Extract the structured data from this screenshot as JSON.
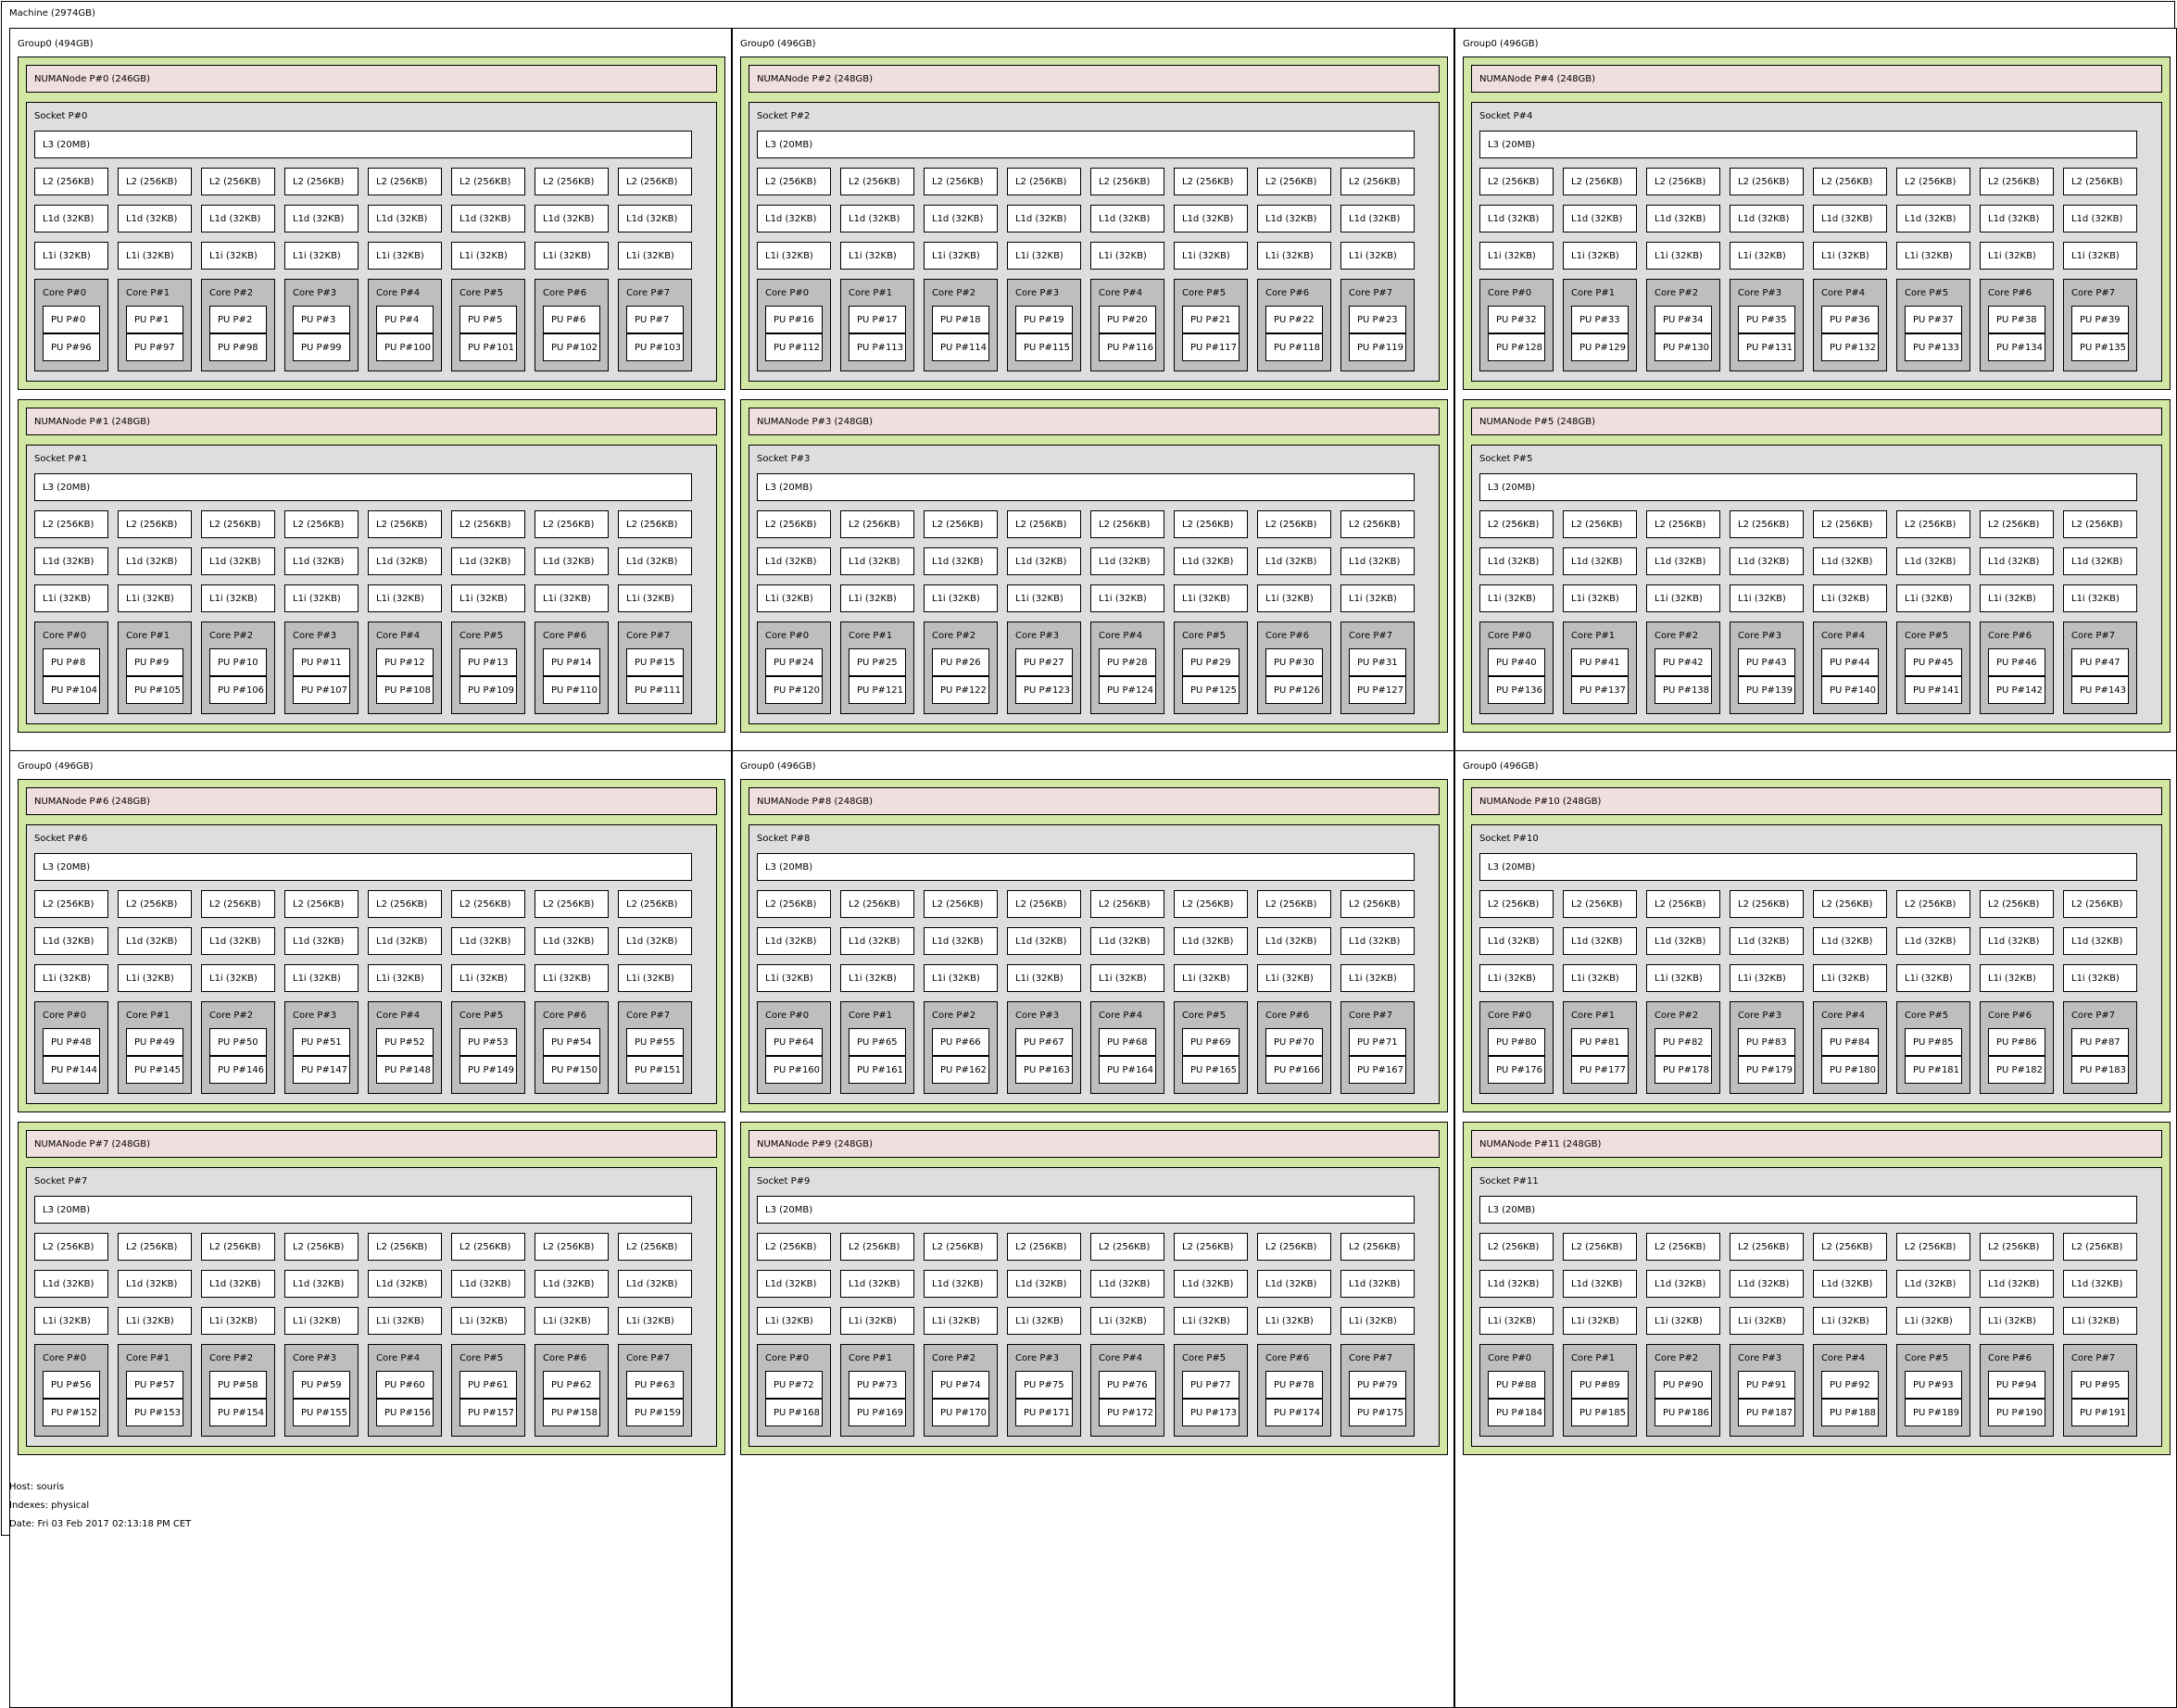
{
  "machine": {
    "label": "Machine (2974GB)"
  },
  "groups": [
    {
      "label": "Group0 (494GB)",
      "numas": [
        {
          "label": "NUMANode P#0 (246GB)",
          "socket": "Socket P#0",
          "pu_start": 0,
          "pu_ht_start": 96
        },
        {
          "label": "NUMANode P#1 (248GB)",
          "socket": "Socket P#1",
          "pu_start": 8,
          "pu_ht_start": 104
        }
      ]
    },
    {
      "label": "Group0 (496GB)",
      "numas": [
        {
          "label": "NUMANode P#2 (248GB)",
          "socket": "Socket P#2",
          "pu_start": 16,
          "pu_ht_start": 112
        },
        {
          "label": "NUMANode P#3 (248GB)",
          "socket": "Socket P#3",
          "pu_start": 24,
          "pu_ht_start": 120
        }
      ]
    },
    {
      "label": "Group0 (496GB)",
      "numas": [
        {
          "label": "NUMANode P#4 (248GB)",
          "socket": "Socket P#4",
          "pu_start": 32,
          "pu_ht_start": 128
        },
        {
          "label": "NUMANode P#5 (248GB)",
          "socket": "Socket P#5",
          "pu_start": 40,
          "pu_ht_start": 136
        }
      ]
    },
    {
      "label": "Group0 (496GB)",
      "numas": [
        {
          "label": "NUMANode P#6 (248GB)",
          "socket": "Socket P#6",
          "pu_start": 48,
          "pu_ht_start": 144
        },
        {
          "label": "NUMANode P#7 (248GB)",
          "socket": "Socket P#7",
          "pu_start": 56,
          "pu_ht_start": 152
        }
      ]
    },
    {
      "label": "Group0 (496GB)",
      "numas": [
        {
          "label": "NUMANode P#8 (248GB)",
          "socket": "Socket P#8",
          "pu_start": 64,
          "pu_ht_start": 160
        },
        {
          "label": "NUMANode P#9 (248GB)",
          "socket": "Socket P#9",
          "pu_start": 72,
          "pu_ht_start": 168
        }
      ]
    },
    {
      "label": "Group0 (496GB)",
      "numas": [
        {
          "label": "NUMANode P#10 (248GB)",
          "socket": "Socket P#10",
          "pu_start": 80,
          "pu_ht_start": 176
        },
        {
          "label": "NUMANode P#11 (248GB)",
          "socket": "Socket P#11",
          "pu_start": 88,
          "pu_ht_start": 184
        }
      ]
    }
  ],
  "caches": {
    "l3": "L3 (20MB)",
    "l2": "L2 (256KB)",
    "l1d": "L1d (32KB)",
    "l1i": "L1i (32KB)"
  },
  "cores_per_socket": 8,
  "core_prefix": "Core P#",
  "pu_prefix": "PU P#",
  "footer": {
    "host": "Host: souris",
    "indexes": "Indexes: physical",
    "date": "Date: Fri 03 Feb 2017 02:13:18 PM CET"
  },
  "colors": {
    "numa": "#d2e7a4",
    "numa_header": "#efdfde",
    "socket": "#dedede",
    "core": "#bebebe",
    "cache": "#ffffff",
    "pu": "#ffffff"
  }
}
